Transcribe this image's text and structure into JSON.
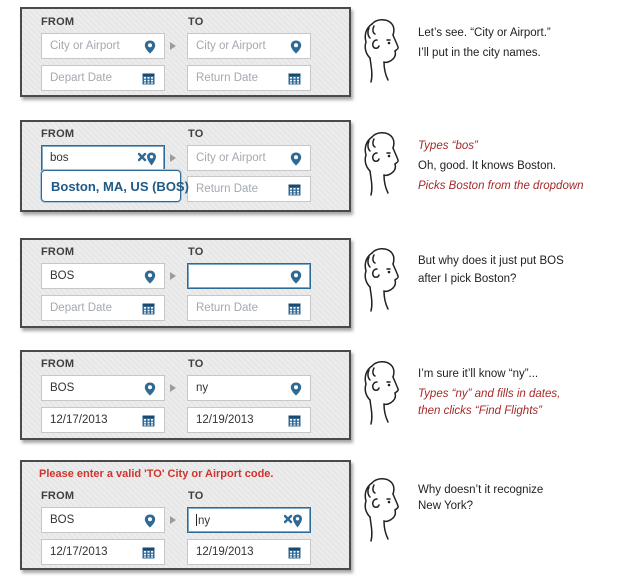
{
  "labels": {
    "from": "FROM",
    "to": "TO"
  },
  "placeholders": {
    "city": "City or Airport",
    "depart": "Depart Date",
    "return": "Return Date"
  },
  "step2": {
    "from_value": "bos",
    "suggestion": "Boston, MA, US (BOS)"
  },
  "step3": {
    "from_value": "BOS",
    "to_value": ""
  },
  "step4": {
    "from_value": "BOS",
    "to_value": "ny",
    "depart_value": "12/17/2013",
    "return_value": "12/19/2013"
  },
  "step5": {
    "error": "Please enter a valid 'TO' City or Airport code.",
    "from_value": "BOS",
    "to_value": "ny",
    "depart_value": "12/17/2013",
    "return_value": "12/19/2013"
  },
  "comments": {
    "c1": [
      "Let’s see. “City or Airport.”",
      "I’ll put in the city names."
    ],
    "c2": {
      "action1": "Types “bos”",
      "line": "Oh, good. It knows Boston.",
      "action2": "Picks Boston from the dropdown"
    },
    "c3": [
      "But why does it just put BOS",
      "after I pick Boston?"
    ],
    "c4": {
      "line": "I’m sure it’ll know “ny”...",
      "action1": "Types “ny” and fills in dates,",
      "action2": "then clicks “Find Flights”"
    },
    "c5": [
      "Why doesn’t it recognize",
      "New York?"
    ]
  },
  "icons": {
    "pin": "location-pin-icon",
    "calendar": "calendar-icon",
    "clear": "clear-x-icon",
    "arrow": "right-arrow-icon",
    "face": "face-sketch-icon"
  },
  "colors": {
    "accent": "#2f6a96",
    "error": "#d0342c",
    "action": "#a52a2a",
    "placeholder": "#a3a9b0"
  }
}
